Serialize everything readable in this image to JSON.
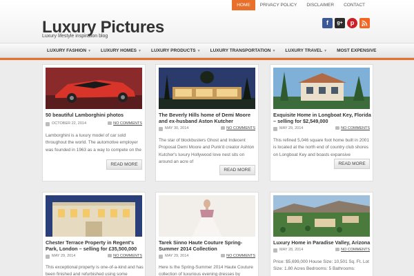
{
  "topnav": {
    "items": [
      "HOME",
      "PRIVACY POLICY",
      "DISCLAIMER",
      "CONTACT"
    ]
  },
  "site": {
    "title": "Luxury Pictures",
    "tagline": "Luxury lifestyle inspiration blog"
  },
  "social": {
    "icons": [
      "facebook-icon",
      "google-plus-icon",
      "pinterest-icon",
      "rss-icon"
    ],
    "colors": [
      "#3b5998",
      "#2c2c2c",
      "#cb2027",
      "#f26522"
    ]
  },
  "mainnav": {
    "items": [
      "LUXURY FASHION",
      "LUXURY HOMES",
      "LUXURY PRODUCTS",
      "LUXURY TRANSPORTATION",
      "LUXURY TRAVEL",
      "MOST EXPENSIVE"
    ]
  },
  "accent": "#e8702a",
  "read_more": "READ MORE",
  "posts": [
    {
      "title": "50 beautiful Lamborghini photos",
      "date": "OCTOBER 22, 2014",
      "comments": "NO COMMENTS",
      "excerpt": "Lamborghini is a luxury model of car sold throughout the world. The automotive employer was founded in 1963 as a way to compete on the"
    },
    {
      "title": "The Beverly Hills home of Demi Moore and ex-husband Aston Kutcher",
      "date": "MAY 30, 2014",
      "comments": "NO COMMENTS",
      "excerpt": "The star of blockbusters Ghost and Indecent Proposal Demi Moore and Punk'd creator Ashton Kutcher's luxury Hollywood love nest sits on around an acre of"
    },
    {
      "title": "Exquisite Home in Longboat Key, Florida – selling for $2,549,000",
      "date": "MAY 29, 2014",
      "comments": "NO COMMENTS",
      "excerpt": "This refined 5,046 square foot home built in 2001 is located at the north end of country club shores on Longboat Key and boasts expansive"
    },
    {
      "title": "Chester Terrace Property in Regent's Park, London – selling for £35,500,000",
      "date": "MAY 29, 2014",
      "comments": "NO COMMENTS",
      "excerpt": "This exceptional property is one-of-a-kind and has been finished and refurbished using some"
    },
    {
      "title": "Tarek Sinno Haute Couture Spring-Summer 2014 Collection",
      "date": "MAY 29, 2014",
      "comments": "NO COMMENTS",
      "excerpt": "Here is the Spring-Summer 2014 Haute Couture collection of luxurious evening dresses by"
    },
    {
      "title": "Luxury Home in Paradise Valley, Arizona",
      "date": "MAY 28, 2014",
      "comments": "NO COMMENTS",
      "excerpt": "Price: $5,699,000 House Size: 10,501 Sq. Ft. Lot Size: 1.80 Acres Bedrooms: 5 Bathrooms:"
    }
  ]
}
